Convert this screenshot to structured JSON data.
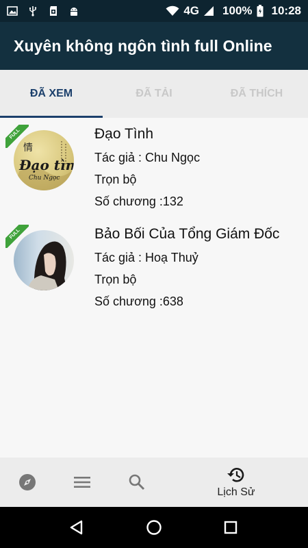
{
  "status_bar": {
    "network": "4G",
    "battery": "100%",
    "time": "10:28"
  },
  "app_bar": {
    "title": "Xuyên không ngôn tình full Online"
  },
  "tabs": [
    {
      "label": "ĐÃ XEM",
      "active": true
    },
    {
      "label": "ĐÃ TẢI",
      "active": false
    },
    {
      "label": "ĐÃ THÍCH",
      "active": false
    }
  ],
  "stories": [
    {
      "badge": "FULL",
      "title": "Đạo Tình",
      "author": "Tác giả : Chu Ngọc",
      "status": "Trọn bộ",
      "chapters": "Số chương :132",
      "cover_text": "Đạo tình",
      "cover_subtext": "Chu Ngọc",
      "cover_char": "情"
    },
    {
      "badge": "FULL",
      "title": "Bảo Bối Của Tổng Giám Đốc",
      "author": "Tác giả : Hoạ Thuỷ",
      "status": "Trọn bộ",
      "chapters": "Số chương :638"
    }
  ],
  "bottom_nav": {
    "items": [
      {
        "icon": "compass-icon"
      },
      {
        "icon": "menu-icon"
      },
      {
        "icon": "search-icon"
      },
      {
        "icon": "history-icon",
        "label": "Lịch Sử",
        "active": true
      }
    ]
  },
  "colors": {
    "status_bar": "#0d2430",
    "app_bar": "#13303f",
    "active_tab": "#1b3f6b",
    "ribbon": "#3fa23b"
  }
}
